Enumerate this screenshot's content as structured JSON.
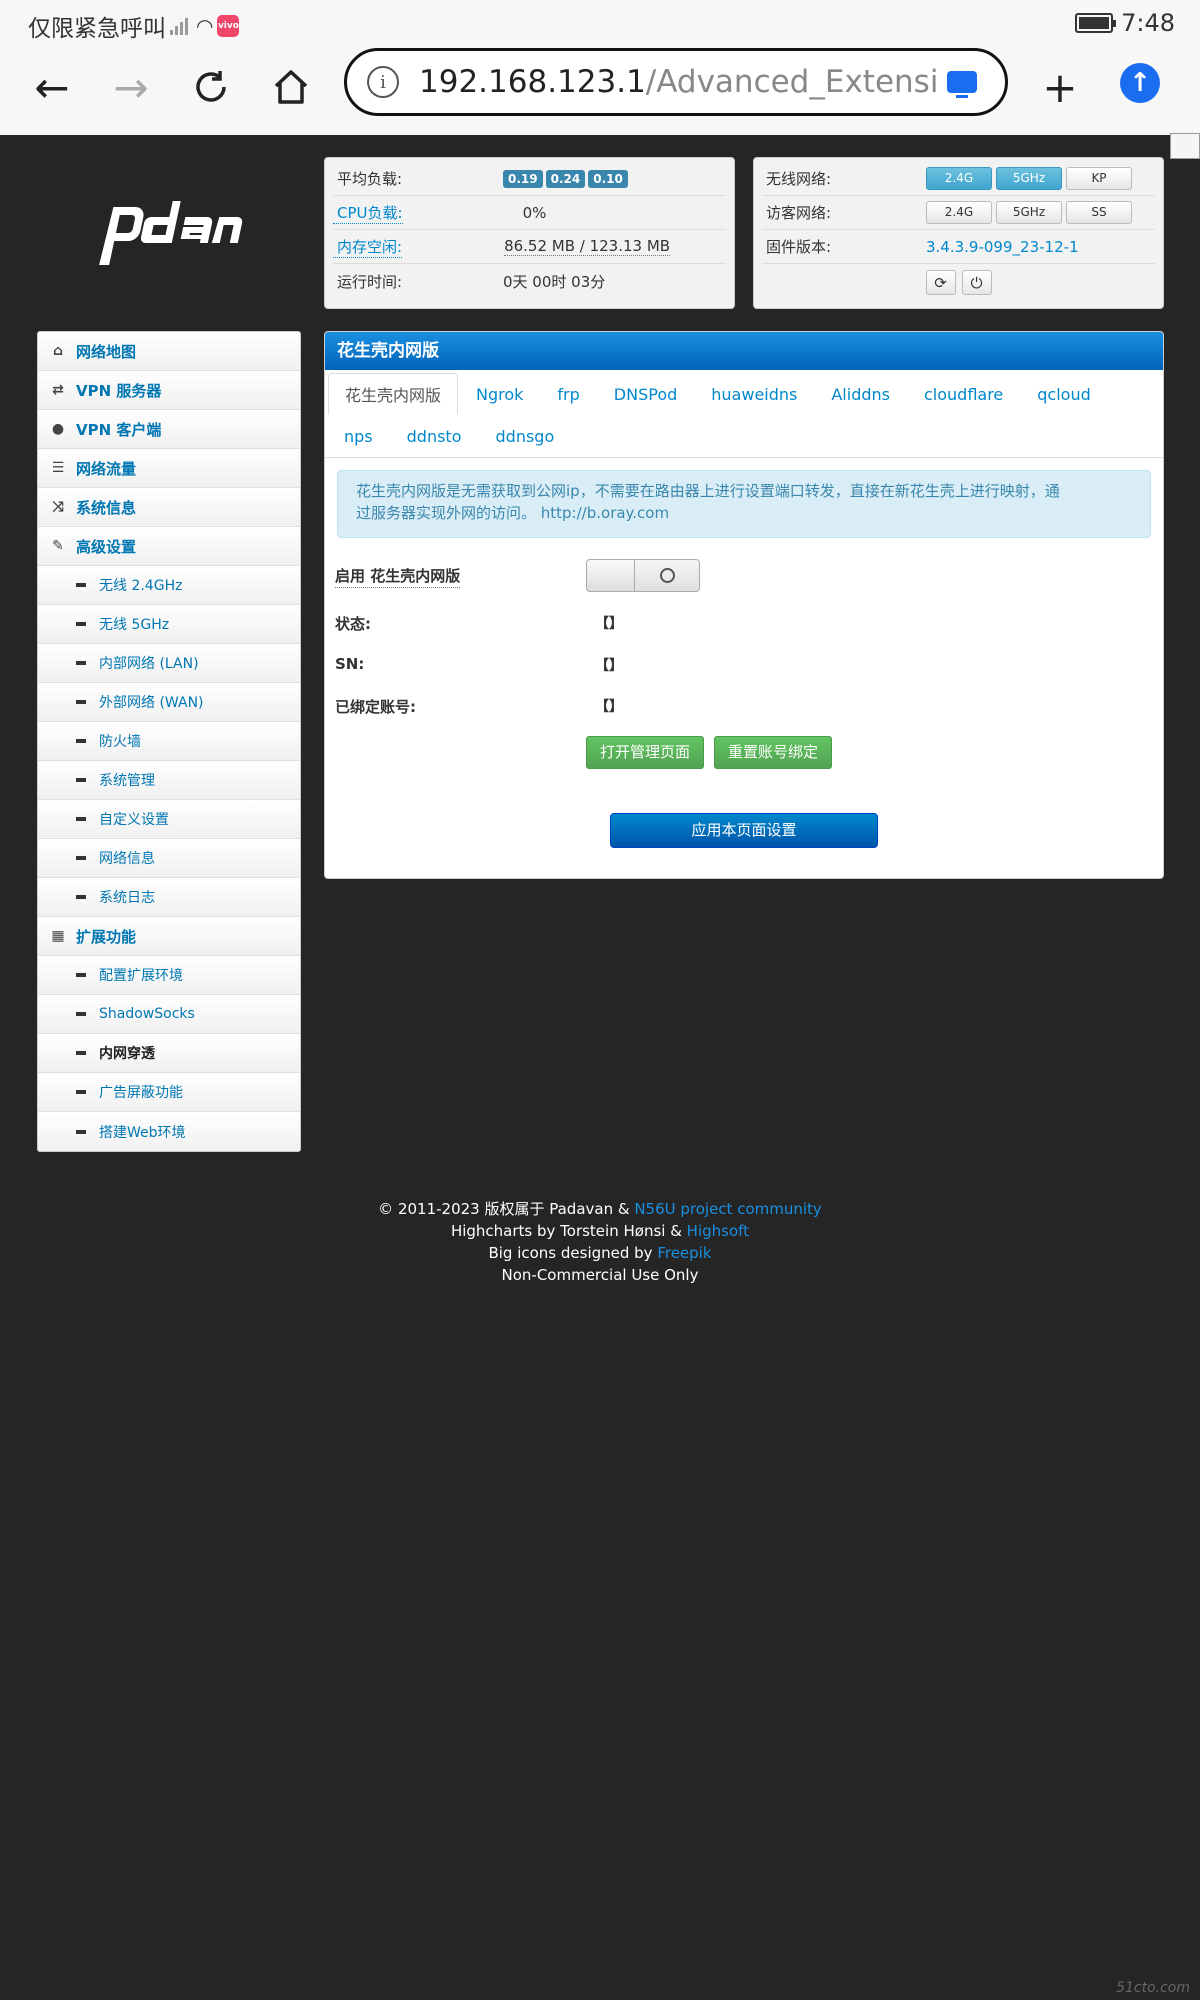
{
  "statusbar": {
    "carrier": "仅限紧急呼叫",
    "app_badge": "vivo",
    "time": "7:48"
  },
  "browser": {
    "url_host": "192.168.123.1",
    "url_path": "/Advanced_Extension"
  },
  "sysinfo": {
    "load_label": "平均负载:",
    "load_values": [
      "0.19",
      "0.24",
      "0.10"
    ],
    "cpu_label": "CPU负载:",
    "cpu_value": "0%",
    "mem_label": "内存空闲:",
    "mem_value": "86.52 MB / 123.13 MB",
    "uptime_label": "运行时间:",
    "uptime_value": "0天 00时 03分"
  },
  "netinfo": {
    "wireless_label": "无线网络:",
    "wireless_buttons": [
      "2.4G",
      "5GHz",
      "KP"
    ],
    "guest_label": "访客网络:",
    "guest_buttons": [
      "2.4G",
      "5GHz",
      "SS"
    ],
    "firmware_label": "固件版本:",
    "firmware_value": "3.4.3.9-099_23-12-1"
  },
  "sidebar": {
    "items": [
      {
        "label": "网络地图",
        "icon": "home-icon"
      },
      {
        "label": "VPN 服务器",
        "icon": "retweet-icon"
      },
      {
        "label": "VPN 客户端",
        "icon": "globe-icon"
      },
      {
        "label": "网络流量",
        "icon": "tasks-icon"
      },
      {
        "label": "系统信息",
        "icon": "random-icon"
      },
      {
        "label": "高级设置",
        "icon": "wrench-icon"
      },
      {
        "label": "无线 2.4GHz"
      },
      {
        "label": "无线 5GHz"
      },
      {
        "label": "内部网络 (LAN)"
      },
      {
        "label": "外部网络 (WAN)"
      },
      {
        "label": "防火墙"
      },
      {
        "label": "系统管理"
      },
      {
        "label": "自定义设置"
      },
      {
        "label": "网络信息"
      },
      {
        "label": "系统日志"
      },
      {
        "label": "扩展功能",
        "icon": "grid-icon"
      },
      {
        "label": "配置扩展环境"
      },
      {
        "label": "ShadowSocks"
      },
      {
        "label": "内网穿透"
      },
      {
        "label": "广告屏蔽功能"
      },
      {
        "label": "搭建Web环境"
      }
    ]
  },
  "main": {
    "title": "花生壳内网版",
    "tabs": [
      "花生壳内网版",
      "Ngrok",
      "frp",
      "DNSPod",
      "huaweidns",
      "Aliddns",
      "cloudflare",
      "qcloud",
      "nps",
      "ddnsto",
      "ddnsgo"
    ],
    "alert_line1": "花生壳内网版是无需获取到公网ip，不需要在路由器上进行设置端口转发，直接在新花生壳上进行映射，通",
    "alert_line2": "过服务器实现外网的访问。 http://b.oray.com",
    "enable_label": "启用 花生壳内网版",
    "status_label": "状态:",
    "status_value": "【】",
    "sn_label": "SN:",
    "sn_value": "【】",
    "account_label": "已绑定账号:",
    "account_value": "【】",
    "open_admin_button": "打开管理页面",
    "reset_binding_button": "重置账号绑定",
    "apply_button": "应用本页面设置"
  },
  "footer": {
    "line1_text": "© 2011-2023 版权属于 Padavan & ",
    "line1_link": "N56U project community",
    "line2_text": "Highcharts by Torstein Hønsi & ",
    "line2_link": "Highsoft",
    "line3_text": "Big icons designed by ",
    "line3_link": "Freepik",
    "line4_text": "Non-Commercial Use Only"
  },
  "colors": {
    "link": "#0088cc",
    "header_blue": "#0063b8",
    "green_button": "#51a351",
    "page_bg": "#252525"
  }
}
